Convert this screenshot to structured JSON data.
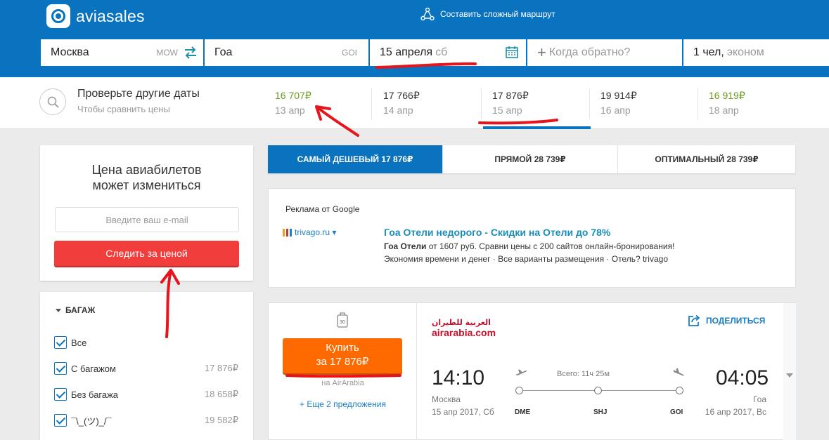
{
  "header": {
    "logo_text": "aviasales",
    "complex_route": "Составить сложный маршрут"
  },
  "search": {
    "from_city": "Москва",
    "from_code": "MOW",
    "to_city": "Гоа",
    "to_code": "GOI",
    "depart_date": "15 апреля",
    "depart_dow": "сб",
    "return_placeholder": "Когда обратно?",
    "passengers": "1 чел,",
    "cabin": "эконом"
  },
  "dates": {
    "title": "Проверьте другие даты",
    "subtitle": "Чтобы сравнить цены",
    "items": [
      {
        "price": "16 707₽",
        "date": "13 апр",
        "cheap": true
      },
      {
        "price": "17 766₽",
        "date": "14 апр",
        "cheap": false
      },
      {
        "price": "17 876₽",
        "date": "15 апр",
        "cheap": false
      },
      {
        "price": "19 914₽",
        "date": "16 апр",
        "cheap": false
      },
      {
        "price": "16 919₽",
        "date": "18 апр",
        "cheap": true
      }
    ]
  },
  "price_alert": {
    "title_line1": "Цена авиабилетов",
    "title_line2": "может измениться",
    "email_placeholder": "Введите ваш e-mail",
    "button": "Следить за ценой"
  },
  "filters": {
    "baggage_title": "БАГАЖ",
    "items": [
      {
        "label": "Все",
        "value": ""
      },
      {
        "label": "С багажом",
        "value": "17 876₽"
      },
      {
        "label": "Без багажа",
        "value": "18 658₽"
      },
      {
        "label": "¯\\_(ツ)_/¯",
        "value": "19 582₽"
      }
    ]
  },
  "tabs": [
    {
      "label": "САМЫЙ ДЕШЕВЫЙ 17 876₽",
      "active": true
    },
    {
      "label": "ПРЯМОЙ 28 739₽",
      "active": false
    },
    {
      "label": "ОПТИМАЛЬНЫЙ 28 739₽",
      "active": false
    }
  ],
  "ad": {
    "label": "Реклама от Google",
    "source": "trivago.ru ▾",
    "title": "Гоа Отели недорого - Скидки на Отели до 78%",
    "line1_bold": "Гоа Отели",
    "line1_rest": " от 1607 руб. Сравни цены с 200 сайтов онлайн-бронирования!",
    "line2": "Экономия времени и денег · Все варианты размещения · Отель? trivago",
    "bar_colors": [
      "#f49f1c",
      "#c33a27",
      "#1d80c3"
    ]
  },
  "ticket": {
    "baggage_kg": "30",
    "buy_line1": "Купить",
    "buy_line2": "за 17 876₽",
    "via": "на AirArabia",
    "more_offers": "+ Еще 2 предложения",
    "airline_ar": "العربية للطيران",
    "airline_en": "airarabia.com",
    "share": "ПОДЕЛИТЬСЯ",
    "dep_time": "14:10",
    "dep_city": "Москва",
    "dep_date": "15 апр 2017, Сб",
    "arr_time": "04:05",
    "arr_city": "Гоа",
    "arr_date": "16 апр 2017, Вс",
    "total": "Всего: 11ч 25м",
    "airports": [
      "DME",
      "SHJ",
      "GOI"
    ]
  },
  "colors": {
    "brand_blue": "#0a73bf",
    "alert_red": "#f23d3d",
    "buy_orange": "#ff6a00",
    "cheap_green": "#6a9a1f",
    "annotation_red": "#e8141b"
  }
}
